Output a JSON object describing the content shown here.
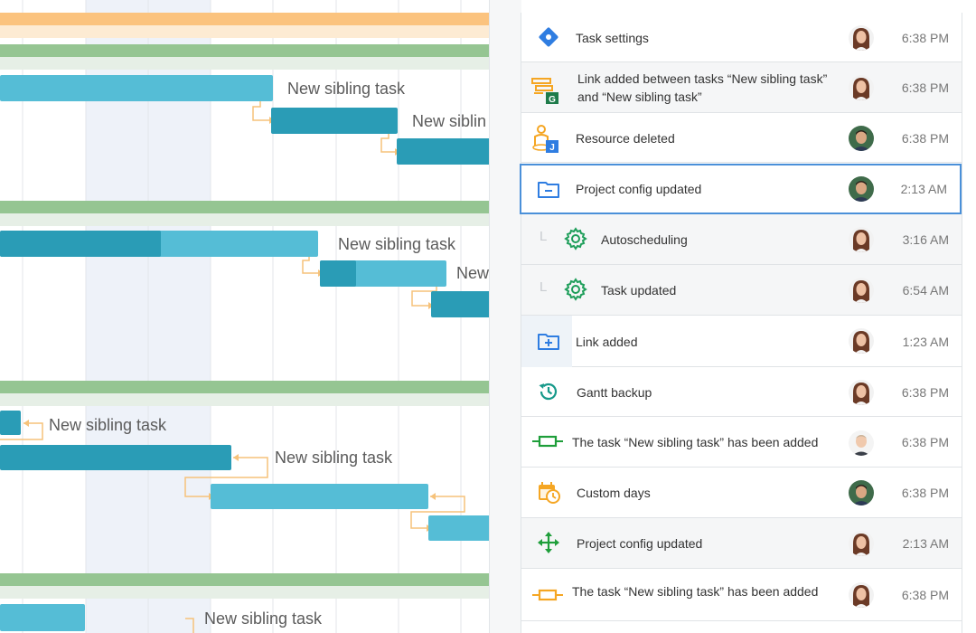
{
  "gantt": {
    "task_labels": [
      "New sibling task",
      "New siblin",
      "New sibling task",
      "New",
      "New sibling task",
      "New sibling task",
      "New sibling task"
    ]
  },
  "history": {
    "items": [
      {
        "title": "Task settings",
        "time": "6:38 PM",
        "icon": "diamond-icon",
        "avatar": "woman"
      },
      {
        "title": "Link added between tasks “New sibling task” and “New sibling task”",
        "time": "6:38 PM",
        "icon": "link-tasks-icon",
        "avatar": "woman"
      },
      {
        "title": "Resource deleted",
        "time": "6:38 PM",
        "icon": "resource-icon",
        "avatar": "man-dark"
      },
      {
        "title": "Project config updated",
        "time": "2:13 AM",
        "icon": "folder-minus-icon",
        "avatar": "man-dark"
      },
      {
        "title": "Autoscheduling",
        "time": "3:16 AM",
        "icon": "gear-icon",
        "avatar": "woman"
      },
      {
        "title": "Task updated",
        "time": "6:54 AM",
        "icon": "gear-icon",
        "avatar": "woman"
      },
      {
        "title": "Link added",
        "time": "1:23 AM",
        "icon": "folder-plus-icon",
        "avatar": "woman"
      },
      {
        "title": "Gantt backup",
        "time": "6:38 PM",
        "icon": "history-icon",
        "avatar": "woman"
      },
      {
        "title": "The task “New sibling task” has been added",
        "time": "6:38 PM",
        "icon": "task-bar-green-icon",
        "avatar": "man-light"
      },
      {
        "title": "Custom days",
        "time": "6:38 PM",
        "icon": "calendar-clock-icon",
        "avatar": "man-dark"
      },
      {
        "title": "Project config updated",
        "time": "2:13 AM",
        "icon": "move-arrows-icon",
        "avatar": "woman"
      },
      {
        "title": "The task “New sibling task” has been added",
        "time": "6:38 PM",
        "icon": "task-bar-orange-icon",
        "avatar": "woman"
      }
    ],
    "indent_marker": "L"
  }
}
